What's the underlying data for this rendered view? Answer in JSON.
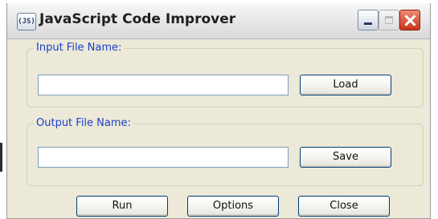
{
  "window": {
    "title": "JavaScript Code Improver",
    "app_icon_text": "(JS)"
  },
  "input_group": {
    "legend": "Input File Name:",
    "value": "",
    "load_label": "Load"
  },
  "output_group": {
    "legend": "Output File Name:",
    "value": "",
    "save_label": "Save"
  },
  "actions": {
    "run_label": "Run",
    "options_label": "Options",
    "close_label": "Close"
  },
  "icons": {
    "minimize": "minimize-icon",
    "maximize": "maximize-icon",
    "close": "close-icon"
  },
  "colors": {
    "dialog_bg": "#ece9d8",
    "legend_text": "#1c3fc9",
    "close_button": "#c9331a"
  }
}
